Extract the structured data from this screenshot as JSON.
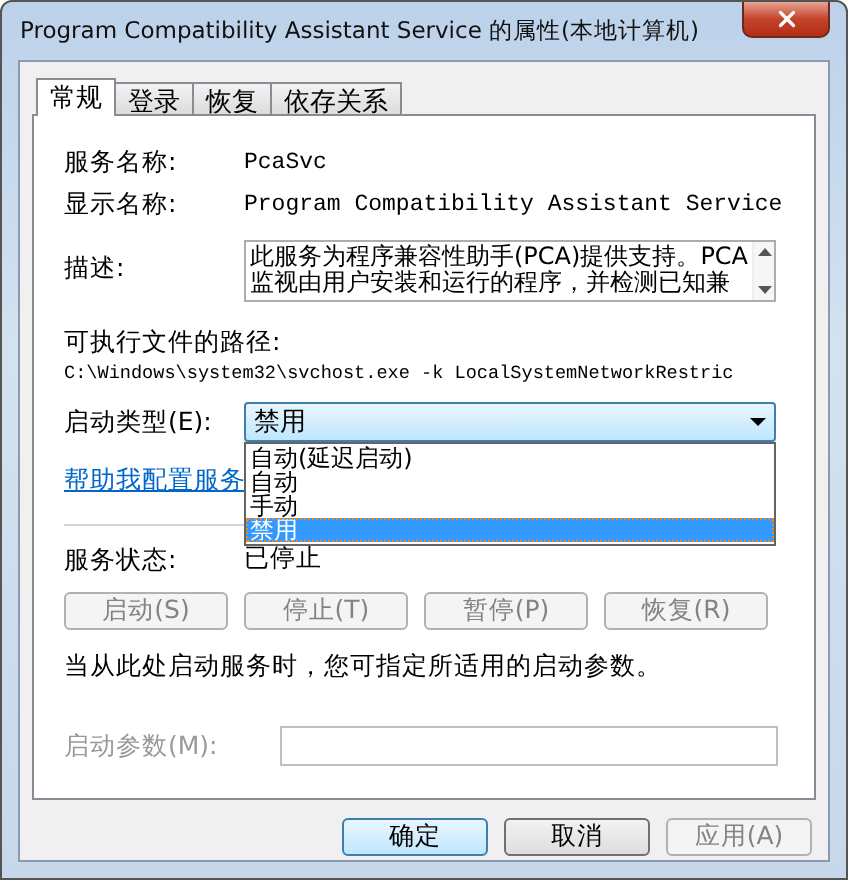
{
  "window": {
    "title": "Program Compatibility Assistant Service 的属性(本地计算机)"
  },
  "tabs": [
    {
      "label": "常规",
      "selected": true
    },
    {
      "label": "登录",
      "selected": false
    },
    {
      "label": "恢复",
      "selected": false
    },
    {
      "label": "依存关系",
      "selected": false
    }
  ],
  "fields": [
    {
      "label": "服务名称:",
      "value": "PcaSvc"
    },
    {
      "label": "显示名称:",
      "value": "Program Compatibility Assistant Service"
    }
  ],
  "description": {
    "label": "描述:",
    "lines": [
      "此服务为程序兼容性助手(PCA)提供支持。PCA",
      "监视由用户安装和运行的程序，并检测已知兼"
    ]
  },
  "path": {
    "label": "可执行文件的路径:",
    "value": "C:\\Windows\\system32\\svchost.exe -k LocalSystemNetworkRestric"
  },
  "startup_type": {
    "label": "启动类型(E):",
    "value": "禁用",
    "expanded": true,
    "options": [
      {
        "label": "自动(延迟启动)",
        "selected": false
      },
      {
        "label": "自动",
        "selected": false
      },
      {
        "label": "手动",
        "selected": false
      },
      {
        "label": "禁用",
        "selected": true
      }
    ]
  },
  "help_link": "帮助我配置服务",
  "service_status": {
    "label": "服务状态:",
    "value": "已停止"
  },
  "control_buttons": [
    {
      "label": "启动(S)",
      "disabled": true
    },
    {
      "label": "停止(T)",
      "disabled": true
    },
    {
      "label": "暂停(P)",
      "disabled": true
    },
    {
      "label": "恢复(R)",
      "disabled": true
    }
  ],
  "hint": "当从此处启动服务时，您可指定所适用的启动参数。",
  "start_params": {
    "label": "启动参数(M):",
    "disabled": true
  },
  "dialog_buttons": [
    {
      "label": "确定",
      "default": true,
      "disabled": false
    },
    {
      "label": "取消",
      "default": false,
      "disabled": false
    },
    {
      "label": "应用(A)",
      "default": false,
      "disabled": true
    }
  ]
}
